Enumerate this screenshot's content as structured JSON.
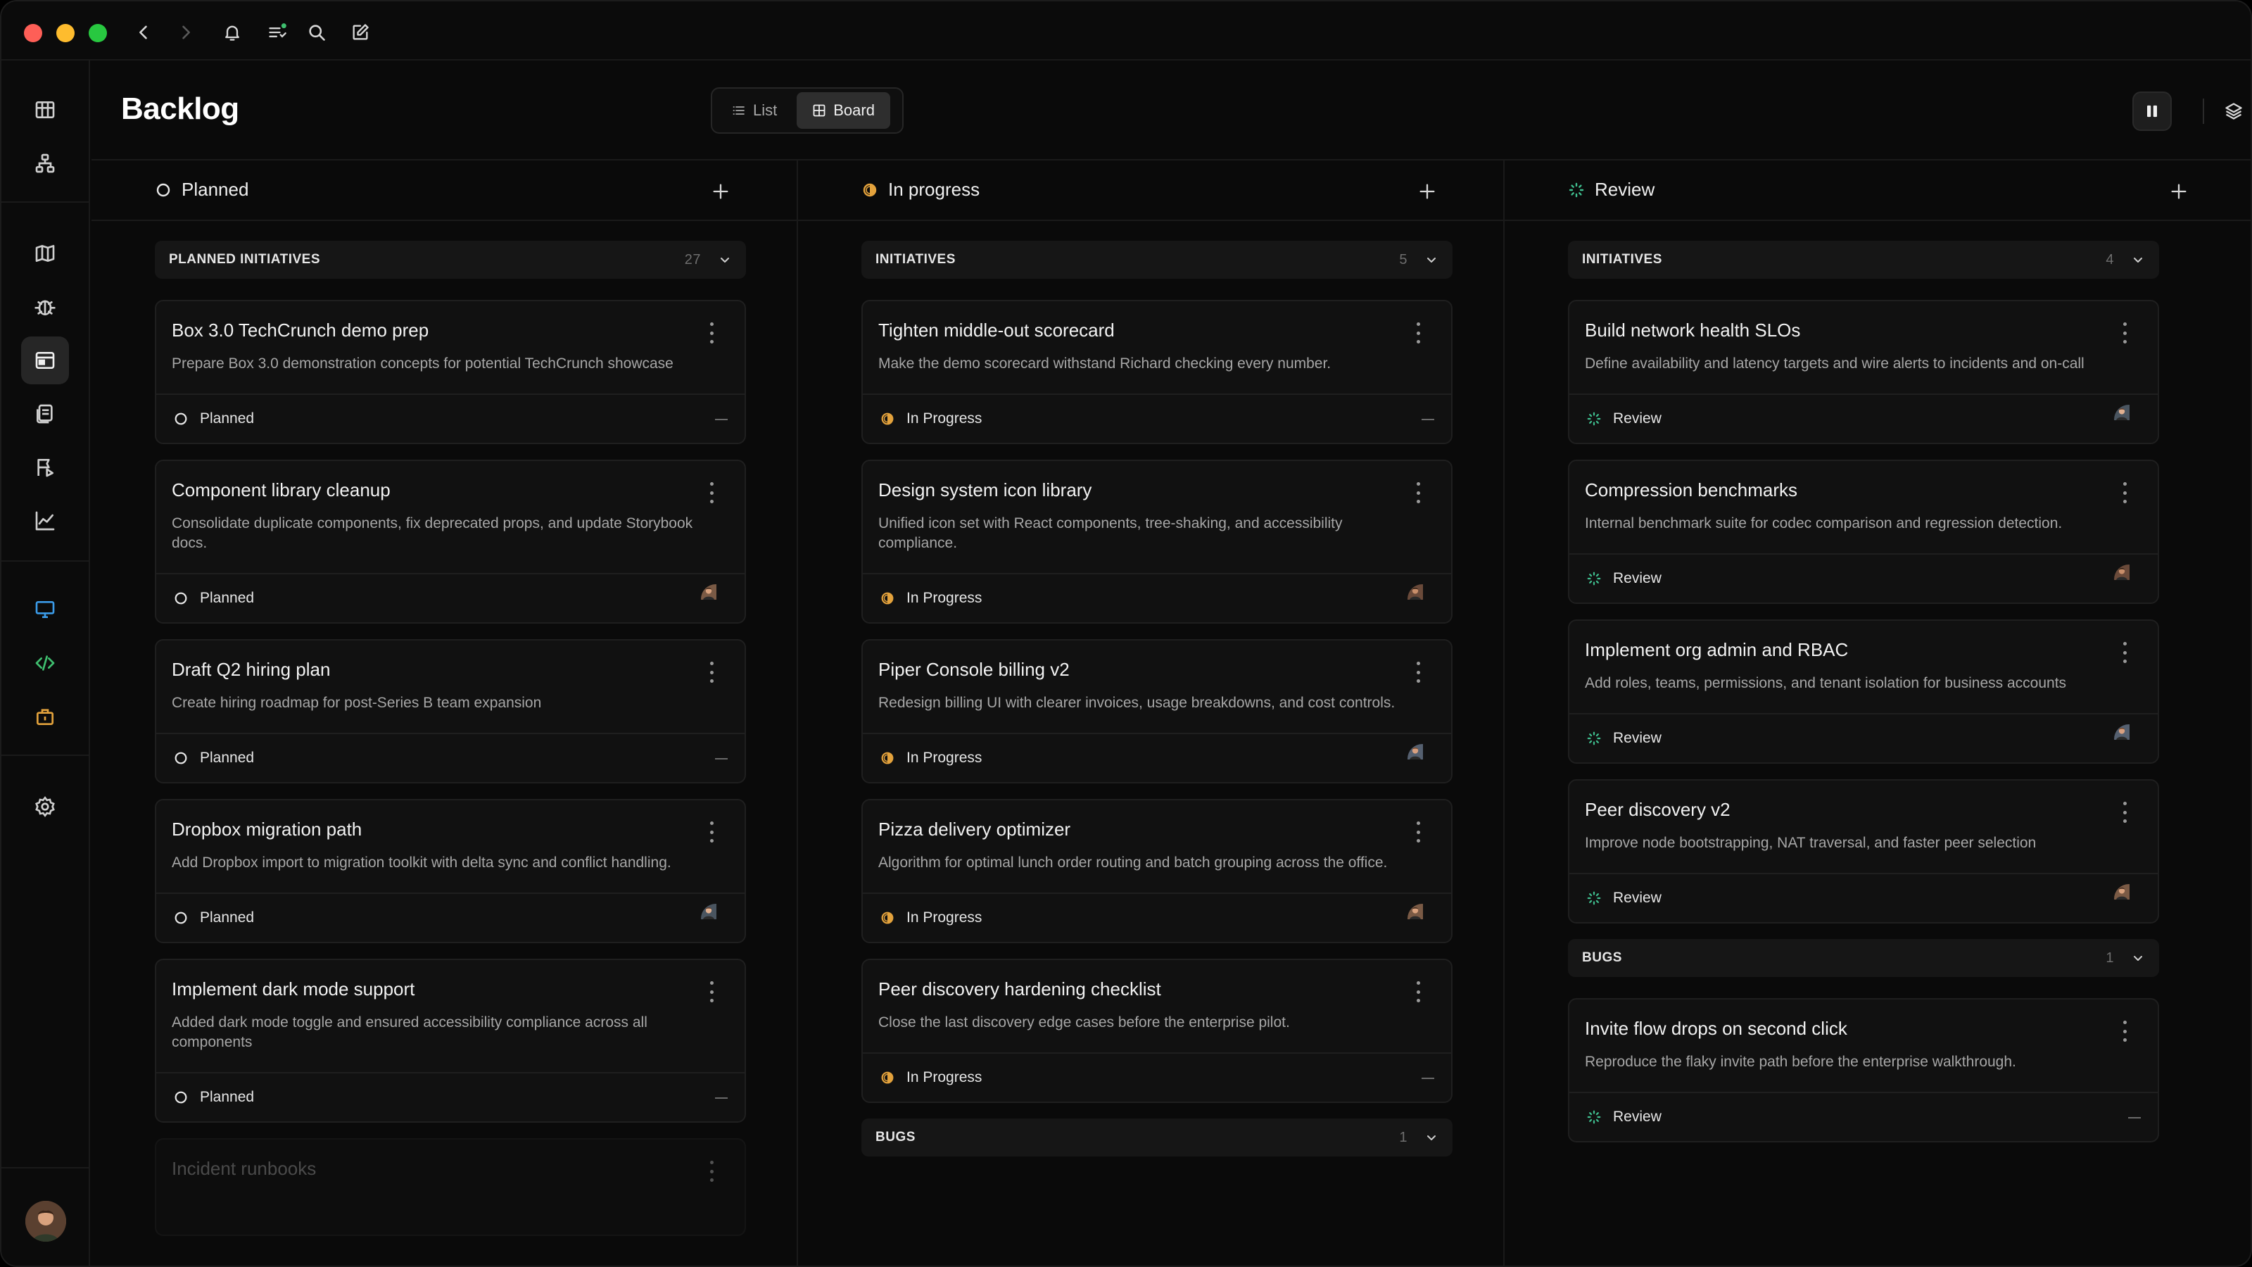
{
  "header": {
    "title": "Backlog",
    "views": [
      "List",
      "Board"
    ],
    "active_view": "Board"
  },
  "colors": {
    "in_progress": "#e3a23c",
    "review": "#3fbf8f",
    "planned": "#e8e8e8"
  },
  "columns": [
    {
      "title": "Planned",
      "status_icon": "circle-outline-icon",
      "groups": [
        {
          "label": "PLANNED INITIATIVES",
          "count": "27",
          "cards": [
            {
              "title": "Box 3.0 TechCrunch demo prep",
              "description": "Prepare Box 3.0 demonstration concepts for potential TechCrunch showcase",
              "status": "Planned"
            },
            {
              "title": "Component library cleanup",
              "description": "Consolidate duplicate components, fix deprecated props, and update Storybook docs.",
              "status": "Planned"
            },
            {
              "title": "Draft Q2 hiring plan",
              "description": "Create hiring roadmap for post-Series B team expansion",
              "status": "Planned"
            },
            {
              "title": "Dropbox migration path",
              "description": "Add Dropbox import to migration toolkit with delta sync and conflict handling.",
              "status": "Planned"
            },
            {
              "title": "Implement dark mode support",
              "description": "Added dark mode toggle and ensured accessibility compliance across all components",
              "status": "Planned"
            },
            {
              "title": "Incident runbooks",
              "description": "",
              "status": ""
            }
          ]
        }
      ]
    },
    {
      "title": "In progress",
      "status_icon": "half-circle-icon",
      "groups": [
        {
          "label": "INITIATIVES",
          "count": "5",
          "cards": [
            {
              "title": "Tighten middle-out scorecard",
              "description": "Make the demo scorecard withstand Richard checking every number.",
              "status": "In Progress"
            },
            {
              "title": "Design system icon library",
              "description": "Unified icon set with React components, tree-shaking, and accessibility compliance.",
              "status": "In Progress"
            },
            {
              "title": "Piper Console billing v2",
              "description": "Redesign billing UI with clearer invoices, usage breakdowns, and cost controls.",
              "status": "In Progress"
            },
            {
              "title": "Pizza delivery optimizer",
              "description": "Algorithm for optimal lunch order routing and batch grouping across the office.",
              "status": "In Progress"
            },
            {
              "title": "Peer discovery hardening checklist",
              "description": "Close the last discovery edge cases before the enterprise pilot.",
              "status": "In Progress"
            }
          ]
        },
        {
          "label": "BUGS",
          "count": "1",
          "cards": []
        }
      ]
    },
    {
      "title": "Review",
      "status_icon": "dotted-circle-icon",
      "groups": [
        {
          "label": "INITIATIVES",
          "count": "4",
          "cards": [
            {
              "title": "Build network health SLOs",
              "description": "Define availability and latency targets and wire alerts to incidents and on-call",
              "status": "Review"
            },
            {
              "title": "Compression benchmarks",
              "description": "Internal benchmark suite for codec comparison and regression detection.",
              "status": "Review"
            },
            {
              "title": "Implement org admin and RBAC",
              "description": "Add roles, teams, permissions, and tenant isolation for business accounts",
              "status": "Review"
            },
            {
              "title": "Peer discovery v2",
              "description": "Improve node bootstrapping, NAT traversal, and faster peer selection",
              "status": "Review"
            }
          ]
        },
        {
          "label": "BUGS",
          "count": "1",
          "cards": [
            {
              "title": "Invite flow drops on second click",
              "description": "Reproduce the flaky invite path before the enterprise walkthrough.",
              "status": "Review"
            }
          ]
        }
      ]
    }
  ]
}
